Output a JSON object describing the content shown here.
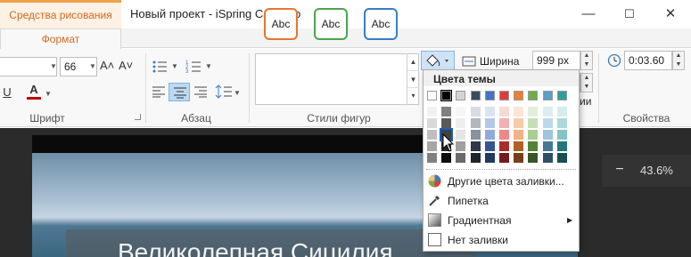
{
  "titlebar": {
    "context_tab": "Средства рисования",
    "app_title": "Новый проект - iSpring Cam Pro",
    "minimize": "—",
    "maximize": "☐",
    "close": "✕"
  },
  "ribbon_tabs": {
    "active": "Формат"
  },
  "font_group": {
    "label": "Шрифт",
    "font_size": "66",
    "grow_icon": "A˄",
    "shrink_icon": "A˅",
    "underline": "U",
    "font_color_letter": "A"
  },
  "paragraph_group": {
    "label": "Абзац"
  },
  "shape_styles_group": {
    "label": "Стили фигур",
    "samples": [
      "Abc",
      "Abc",
      "Abc"
    ],
    "sample_colors": [
      "#e8762d",
      "#4aa64a",
      "#3b7cc4"
    ]
  },
  "size_group": {
    "width_label": "Ширина",
    "width_value": "999 px",
    "truncated_label": "ии"
  },
  "properties_group": {
    "label": "Свойства",
    "time_value": "0:03.60"
  },
  "canvas": {
    "caption": "Великолепная Сицилия",
    "zoom_value": "43.6%",
    "zoom_minus": "−"
  },
  "fill_dropdown": {
    "header": "Цвета темы",
    "theme_colors": [
      "#ffffff",
      "#000000",
      "#d4d4d4",
      "#3a4a5e",
      "#4472c4",
      "#e23a3a",
      "#ed7d31",
      "#70ad47",
      "#5aa0c8",
      "#2f9ea0"
    ],
    "items": [
      {
        "label": "Другие цвета заливки...",
        "icon": "palette-icon"
      },
      {
        "label": "Пипетка",
        "icon": "eyedropper-icon"
      },
      {
        "label": "Градиентная",
        "icon": "gradient-icon",
        "submenu": true
      },
      {
        "label": "Нет заливки",
        "icon": "no-fill-icon"
      }
    ]
  }
}
